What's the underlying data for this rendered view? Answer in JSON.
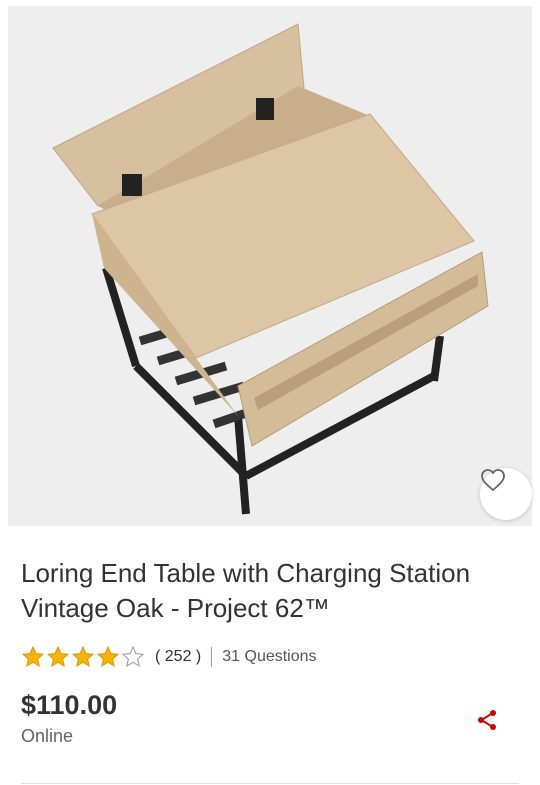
{
  "product": {
    "title": "Loring End Table with Charging Station Vintage Oak - Project 62™",
    "rating": 4,
    "rating_max": 5,
    "reviews_label": "( 252 )",
    "questions_label": "31 Questions",
    "price": "$110.00",
    "availability": "Online"
  },
  "colors": {
    "accent": "#cc0000",
    "star": "#f5b400",
    "wood": "#d9c2a2",
    "metal": "#222222"
  },
  "icons": {
    "favorite": "heart-icon",
    "share": "share-icon",
    "star": "star-icon"
  }
}
